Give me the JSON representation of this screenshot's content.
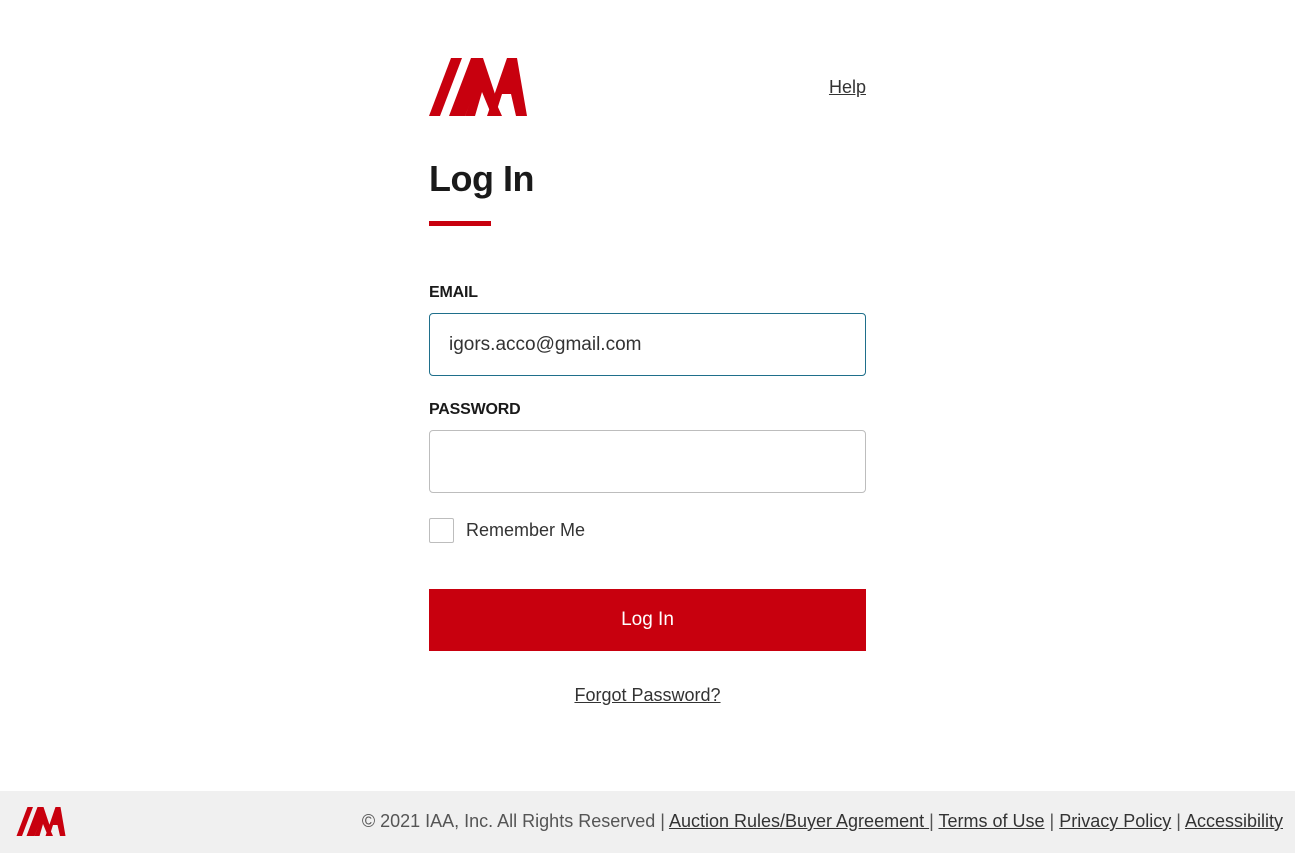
{
  "brand": {
    "accent_color": "#c8000e",
    "logo_text": "IAA"
  },
  "header": {
    "help_label": "Help"
  },
  "page": {
    "title": "Log In"
  },
  "form": {
    "email_label": "EMAIL",
    "email_value": "igors.acco@gmail.com",
    "password_label": "PASSWORD",
    "password_value": "",
    "remember_label": "Remember Me",
    "remember_checked": false,
    "submit_label": "Log In",
    "forgot_label": "Forgot Password?"
  },
  "footer": {
    "copyright": "© 2021 IAA, Inc. All Rights Reserved",
    "separator": "|",
    "links": [
      "Auction Rules/Buyer Agreement ",
      "Terms of Use",
      "Privacy Policy",
      "Accessibility"
    ]
  }
}
